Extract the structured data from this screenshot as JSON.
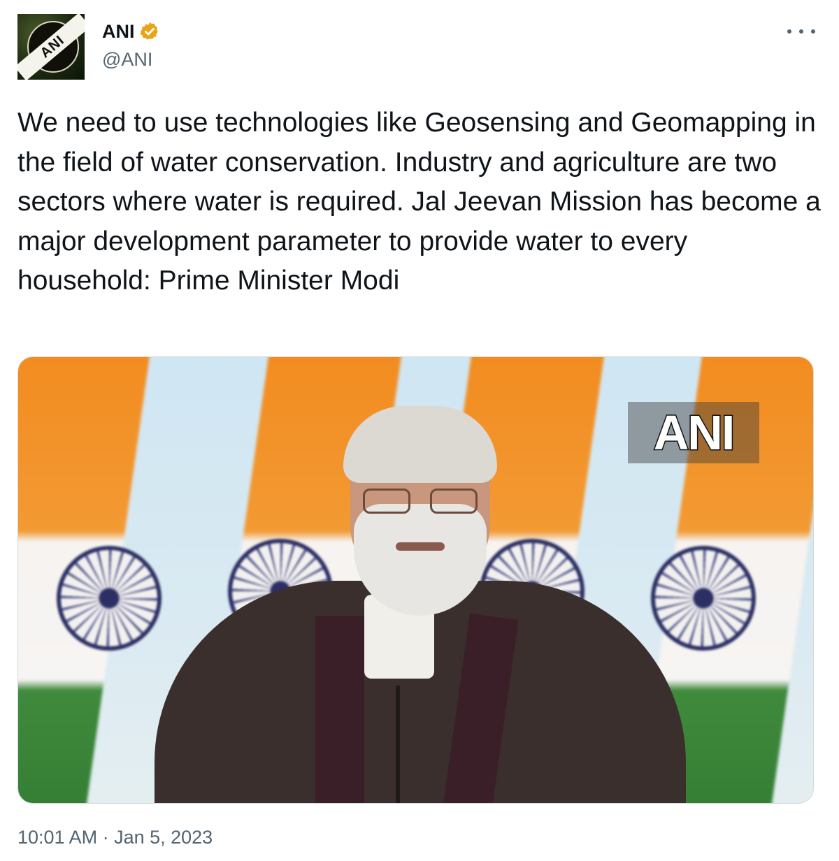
{
  "account": {
    "display_name": "ANI",
    "handle": "@ANI",
    "avatar_text": "ANI",
    "verified_color": "#E8A317"
  },
  "tweet": {
    "text": "We need to use technologies like Geosensing and Geomapping in the field of water conservation. Industry and agriculture are two sectors where water is required. Jal Jeevan Mission has become a major development parameter to provide water to every household: Prime Minister Modi",
    "timestamp": "10:01 AM · Jan 5, 2023"
  },
  "media": {
    "watermark": "ANI"
  },
  "icons": {
    "more": "more-options-icon",
    "verified": "verified-badge-icon"
  },
  "colors": {
    "text": "#0f1419",
    "secondary": "#536471",
    "saffron": "#f28a1d",
    "green": "#2f7a30"
  }
}
